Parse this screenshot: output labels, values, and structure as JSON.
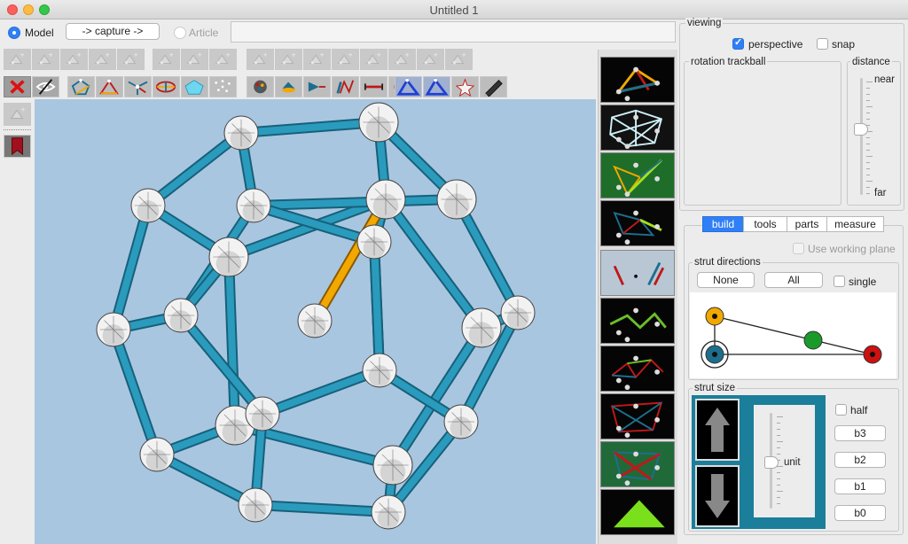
{
  "window": {
    "title": "Untitled 1"
  },
  "mode": {
    "model_label": "Model",
    "capture_label": "-> capture ->",
    "article_label": "Article"
  },
  "viewing": {
    "title": "viewing",
    "perspective_label": "perspective",
    "perspective_checked": true,
    "snap_label": "snap",
    "snap_checked": false,
    "trackball_title": "rotation trackball",
    "distance_title": "distance",
    "near_label": "near",
    "far_label": "far"
  },
  "tabs": [
    {
      "label": "build",
      "selected": true
    },
    {
      "label": "tools",
      "selected": false
    },
    {
      "label": "parts",
      "selected": false
    },
    {
      "label": "measure",
      "selected": false
    }
  ],
  "build": {
    "working_plane_label": "Use working plane",
    "strut_directions_title": "strut directions",
    "none_label": "None",
    "all_label": "All",
    "single_label": "single",
    "strut_size_title": "strut size",
    "half_label": "half",
    "unit_label": "unit",
    "size_buttons": [
      "b3",
      "b2",
      "b1",
      "b0"
    ],
    "direction_colors": {
      "yellow": "#f2a800",
      "blue": "#1d6e8d",
      "green": "#1a9a2a",
      "red": "#cc1111"
    }
  },
  "toolbar_icons": {
    "row1": [
      "ghost-tool-icon",
      "ghost-tool-icon",
      "ghost-tool-icon",
      "ghost-tool-icon",
      "ghost-tool-icon",
      "ghost-tool-icon",
      "ghost-tool-icon",
      "ghost-tool-icon",
      "ghost-tool-icon",
      "ghost-tool-icon",
      "ghost-tool-icon",
      "ghost-tool-icon",
      "ghost-tool-icon",
      "ghost-tool-icon",
      "ghost-tool-icon",
      "ghost-tool-icon"
    ],
    "row2": [
      "delete-icon",
      "hide-icon",
      "pentagon-struts-icon",
      "triangle-struts-icon",
      "axes-icon",
      "panel-icon",
      "panel-fill-icon",
      "balls-icon",
      "sphere-icon",
      "cone-icon",
      "vector-icon",
      "strut-icon",
      "arrows-icon",
      "wheel-icon",
      "triangle-tool-icon",
      "triangle-tool-icon",
      "star-icon",
      "pen-icon"
    ]
  },
  "colors": {
    "accent": "#2f7ff7",
    "viewport": "#a9c6e0",
    "strut": "#2a9bbd",
    "panel_teal": "#1b7e9a"
  }
}
